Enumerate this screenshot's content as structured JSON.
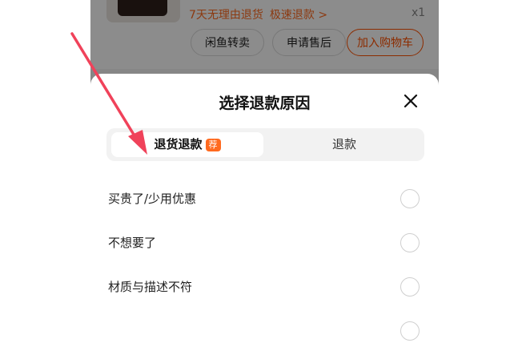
{
  "order": {
    "promo_text": "7天无理由退货",
    "promo_link": "极速退款 >",
    "quantity": "x1",
    "buttons": [
      "闲鱼转卖",
      "申请售后",
      "加入购物车"
    ]
  },
  "sheet": {
    "title": "选择退款原因",
    "tabs": [
      {
        "label": "退货退款",
        "badge": "荐",
        "selected": true
      },
      {
        "label": "退款",
        "selected": false
      }
    ],
    "reasons": [
      {
        "label": "买贵了/少用优惠"
      },
      {
        "label": "不想要了"
      },
      {
        "label": "材质与描述不符"
      }
    ]
  },
  "colors": {
    "accent": "#ff6a1f",
    "annotation_arrow": "#f0425a"
  }
}
